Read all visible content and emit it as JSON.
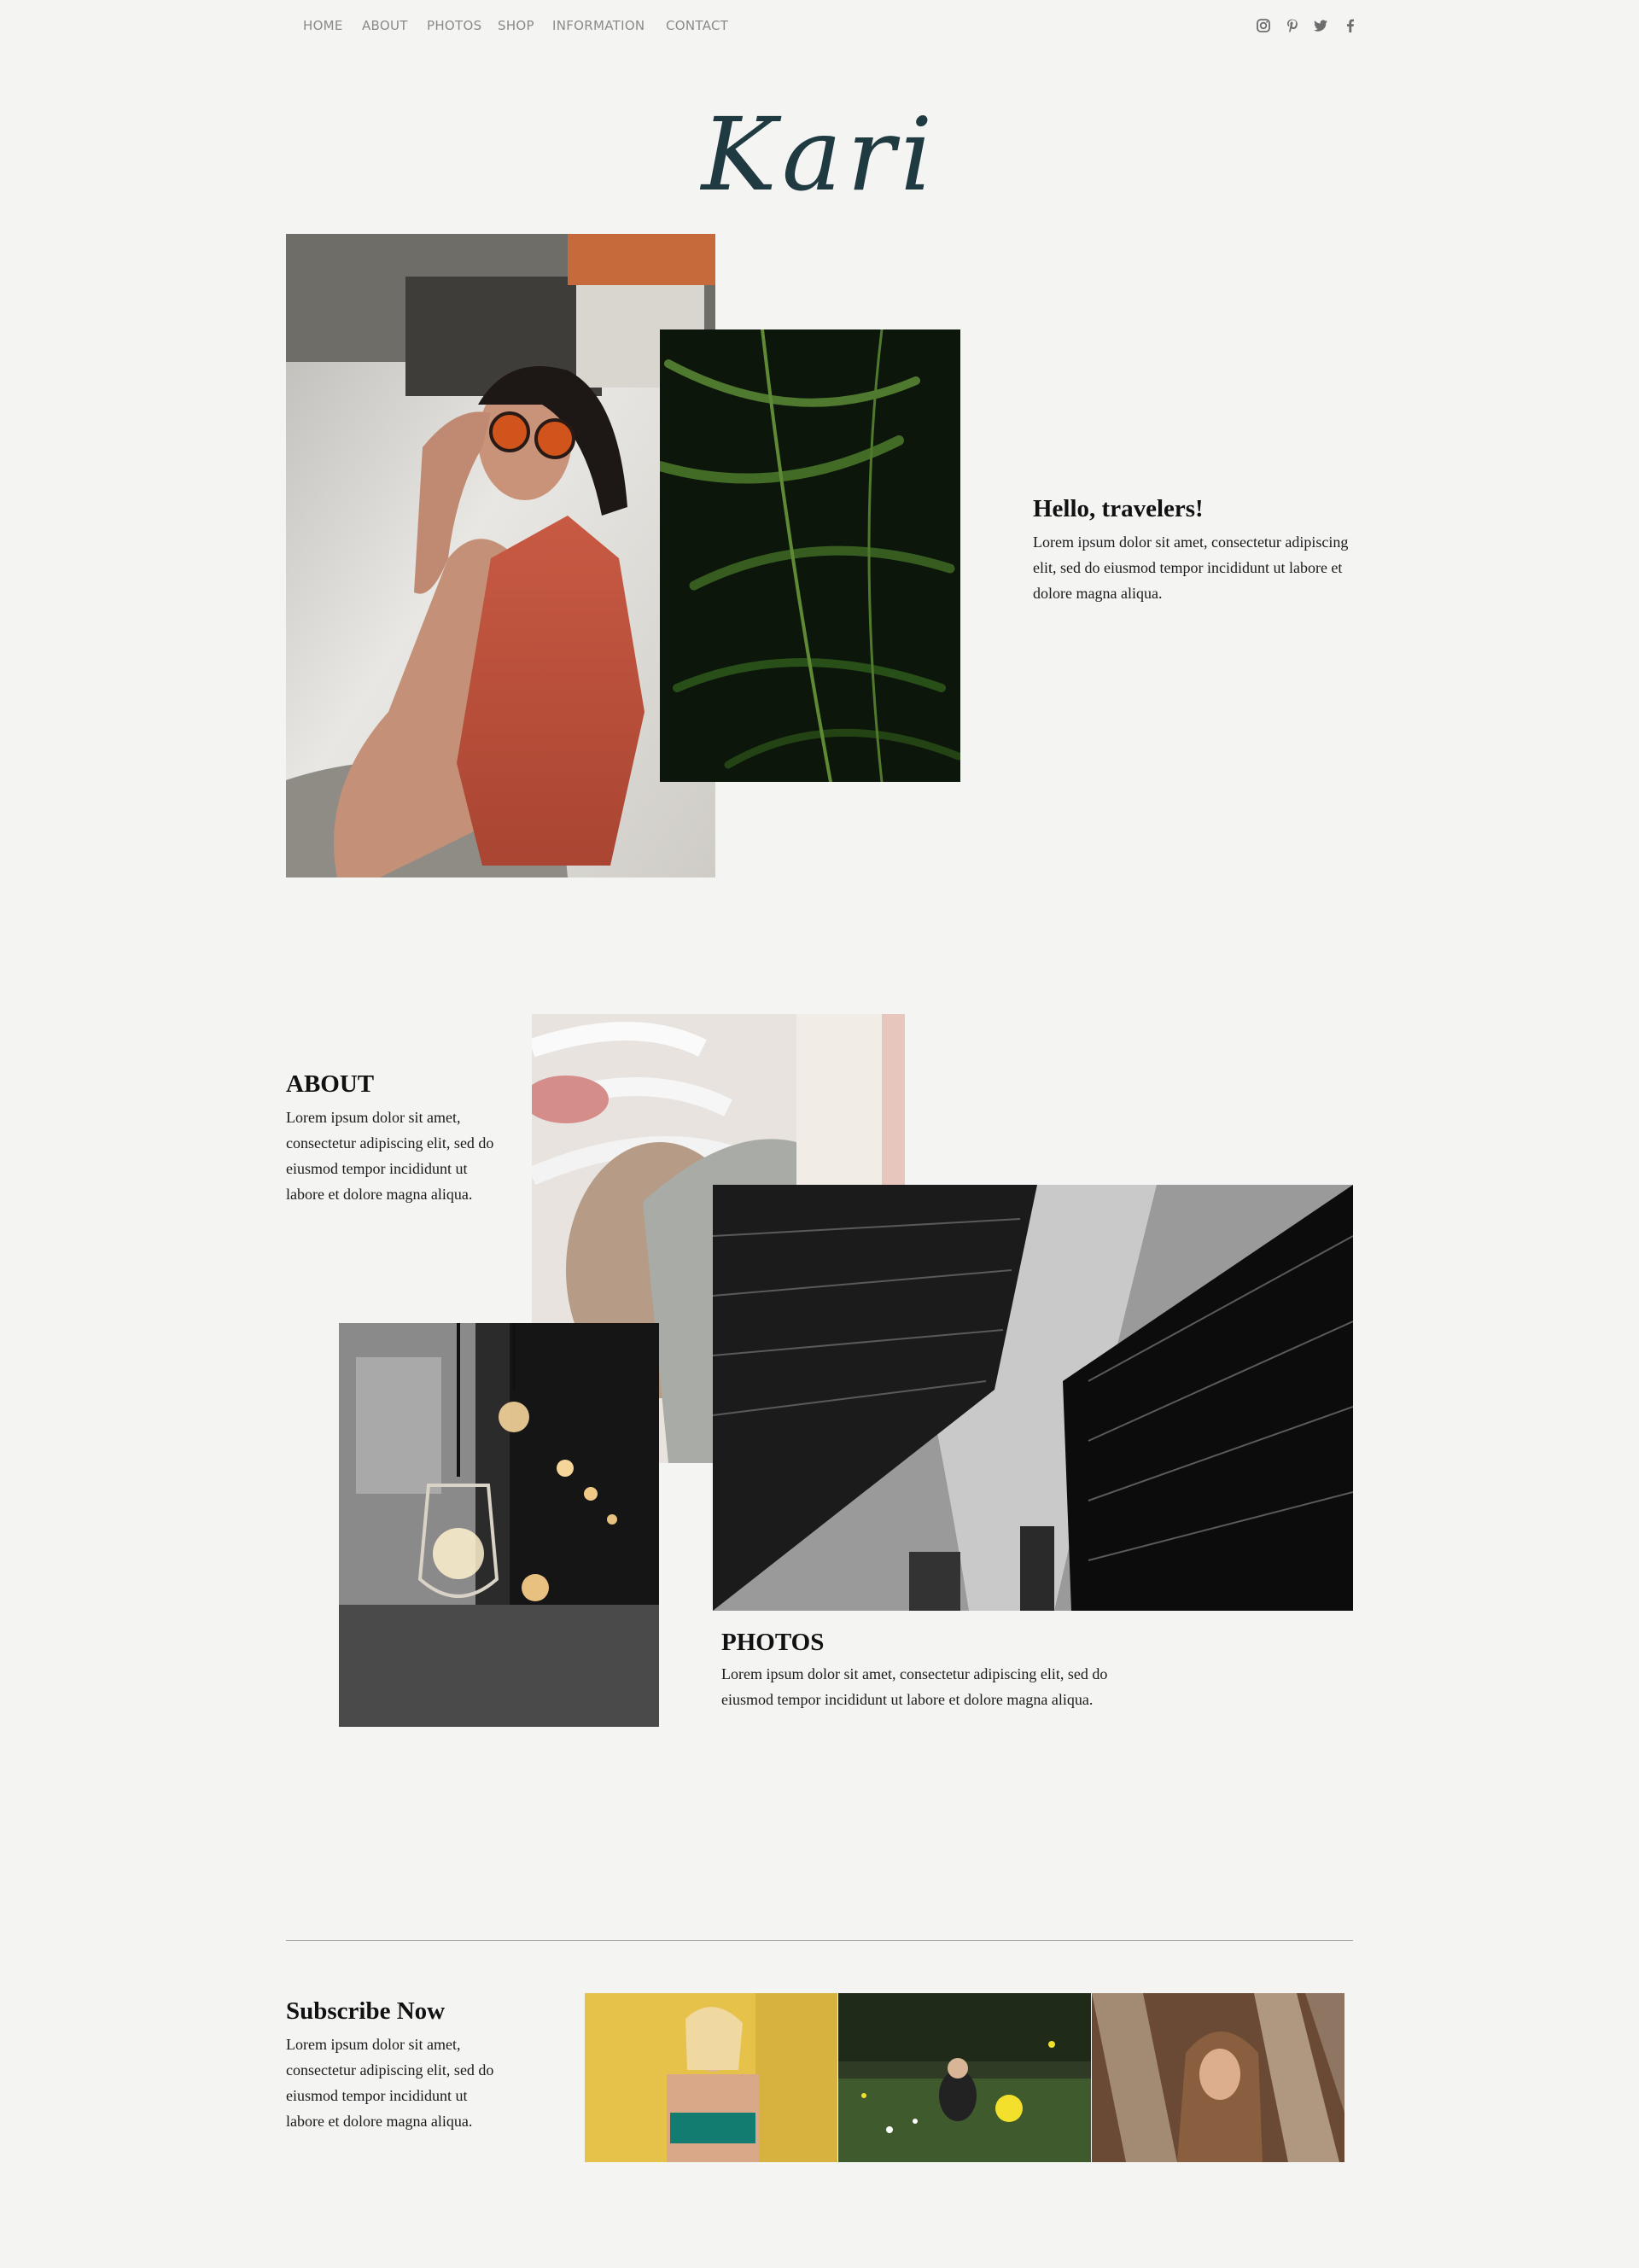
{
  "nav": {
    "items": [
      "HOME",
      "ABOUT",
      "PHOTOS",
      "SHOP",
      "INFORMATION",
      "CONTACT"
    ],
    "social_icons": [
      "instagram-icon",
      "pinterest-icon",
      "twitter-icon",
      "facebook-icon"
    ]
  },
  "logo": {
    "text": "Kari"
  },
  "hero": {
    "title": "Hello, travelers!",
    "body": "Lorem ipsum dolor sit amet, consectetur adipiscing elit, sed do eiusmod tempor incididunt ut labore et dolore magna aliqua."
  },
  "about": {
    "title": "ABOUT",
    "body": "Lorem ipsum dolor sit amet, consectetur adipiscing elit, sed do eiusmod tempor incididunt ut labore et dolore magna aliqua."
  },
  "photos": {
    "title": "PHOTOS",
    "body": "Lorem ipsum dolor sit amet, consectetur adipiscing elit, sed do eiusmod tempor incididunt ut labore et dolore magna aliqua."
  },
  "subscribe": {
    "title": "Subscribe Now",
    "body": "Lorem ipsum dolor sit amet, consectetur adipiscing elit, sed do eiusmod tempor incididunt ut labore et dolore magna aliqua."
  },
  "colors": {
    "background": "#f4f4f3",
    "logo": "#1f3a40",
    "nav_text": "#8a8a8a",
    "divider": "#9b9b9b"
  }
}
